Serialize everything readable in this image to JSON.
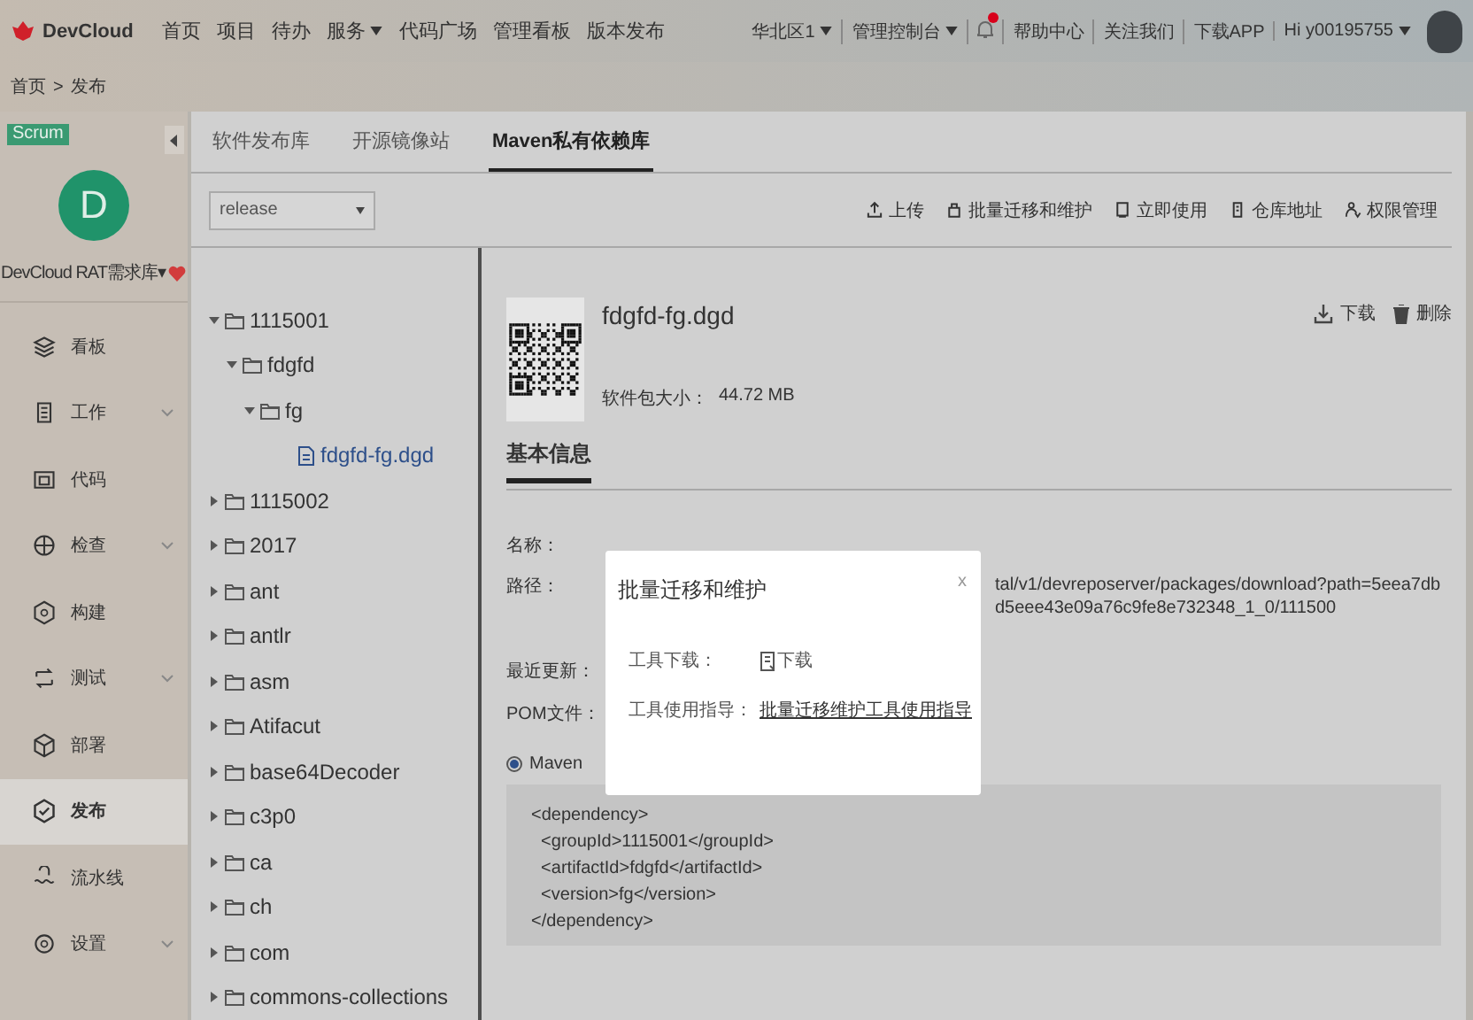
{
  "top_nav": {
    "brand": "DevCloud",
    "menu": [
      {
        "label": "首页",
        "dropdown": false
      },
      {
        "label": "项目",
        "dropdown": false
      },
      {
        "label": "待办",
        "dropdown": false
      },
      {
        "label": "服务",
        "dropdown": true
      },
      {
        "label": "代码广场",
        "dropdown": false
      },
      {
        "label": "管理看板",
        "dropdown": false
      },
      {
        "label": "版本发布",
        "dropdown": false
      }
    ],
    "right": [
      {
        "kind": "link",
        "label": "华北区1",
        "dropdown": true
      },
      {
        "kind": "link",
        "label": "管理控制台",
        "dropdown": true
      },
      {
        "kind": "bell",
        "unread": true
      },
      {
        "kind": "link",
        "label": "帮助中心",
        "dropdown": false
      },
      {
        "kind": "link",
        "label": "关注我们",
        "dropdown": false
      },
      {
        "kind": "link",
        "label": "下载APP",
        "dropdown": false
      },
      {
        "kind": "link",
        "label": "Hi y00195755",
        "dropdown": true
      }
    ]
  },
  "breadcrumb": {
    "items": [
      "首页",
      "发布"
    ],
    "separator": ">"
  },
  "sidebar": {
    "badge": "Scrum",
    "avatar_letter": "D",
    "project_name": "DevCloud RAT需求库▾",
    "favorite": true,
    "items": [
      {
        "label": "看板",
        "expandable": false,
        "selected": false
      },
      {
        "label": "工作",
        "expandable": true,
        "selected": false
      },
      {
        "label": "代码",
        "expandable": false,
        "selected": false
      },
      {
        "label": "检查",
        "expandable": true,
        "selected": false
      },
      {
        "label": "构建",
        "expandable": false,
        "selected": false
      },
      {
        "label": "测试",
        "expandable": true,
        "selected": false
      },
      {
        "label": "部署",
        "expandable": false,
        "selected": false
      },
      {
        "label": "发布",
        "expandable": false,
        "selected": true
      },
      {
        "label": "流水线",
        "expandable": false,
        "selected": false
      },
      {
        "label": "设置",
        "expandable": true,
        "selected": false
      }
    ]
  },
  "tabs": [
    {
      "label": "软件发布库",
      "selected": false
    },
    {
      "label": "开源镜像站",
      "selected": false
    },
    {
      "label": "Maven私有依赖库",
      "selected": true
    }
  ],
  "repo_select": {
    "value": "release"
  },
  "toolbar": [
    "上传",
    "批量迁移和维护",
    "立即使用",
    "仓库地址",
    "权限管理"
  ],
  "tree": [
    {
      "kind": "folder",
      "label": "1115001",
      "expanded": true,
      "selected": false,
      "children": [
        {
          "kind": "folder",
          "label": "fdgfd",
          "expanded": true,
          "selected": false,
          "children": [
            {
              "kind": "folder",
              "label": "fg",
              "expanded": true,
              "selected": false,
              "children": [
                {
                  "kind": "file",
                  "label": "fdgfd-fg.dgd",
                  "selected": true
                }
              ]
            }
          ]
        }
      ]
    },
    {
      "kind": "folder",
      "label": "1115002",
      "expanded": false,
      "selected": false
    },
    {
      "kind": "folder",
      "label": "2017",
      "expanded": false,
      "selected": false
    },
    {
      "kind": "folder",
      "label": "ant",
      "expanded": false,
      "selected": false
    },
    {
      "kind": "folder",
      "label": "antlr",
      "expanded": false,
      "selected": false
    },
    {
      "kind": "folder",
      "label": "asm",
      "expanded": false,
      "selected": false
    },
    {
      "kind": "folder",
      "label": "Atifacut",
      "expanded": false,
      "selected": false
    },
    {
      "kind": "folder",
      "label": "base64Decoder",
      "expanded": false,
      "selected": false
    },
    {
      "kind": "folder",
      "label": "c3p0",
      "expanded": false,
      "selected": false
    },
    {
      "kind": "folder",
      "label": "ca",
      "expanded": false,
      "selected": false
    },
    {
      "kind": "folder",
      "label": "ch",
      "expanded": false,
      "selected": false
    },
    {
      "kind": "folder",
      "label": "com",
      "expanded": false,
      "selected": false
    },
    {
      "kind": "folder",
      "label": "commons-collections",
      "expanded": false,
      "selected": false
    }
  ],
  "file": {
    "name": "fdgfd-fg.dgd",
    "size_label": "软件包大小：",
    "size": "44.72 MB",
    "actions": [
      "下载",
      "删除"
    ]
  },
  "section_tab": "基本信息",
  "fields": [
    {
      "label": "名称："
    },
    {
      "label": "路径：",
      "value": "tal/v1/devreposerver/packages/download?path=5eea7dbd5eee43e09a76c9fe8e732348_1_0/111500"
    },
    {
      "label": "最近更新："
    },
    {
      "label": "POM文件："
    }
  ],
  "pom_formats": [
    {
      "label": "Maven",
      "selected": true
    }
  ],
  "pom_code": [
    "<dependency>",
    "  <groupId>1115001</groupId>",
    "  <artifactId>fdgfd</artifactId>",
    "  <version>fg</version>",
    "</dependency>"
  ],
  "dialog": {
    "title": "批量迁移和维护",
    "close": "x",
    "rows": [
      {
        "kind": "download",
        "label": "工具下载：",
        "link": "下载"
      },
      {
        "kind": "guide",
        "label": "工具使用指导：",
        "link": "批量迁移维护工具使用指导"
      }
    ]
  }
}
